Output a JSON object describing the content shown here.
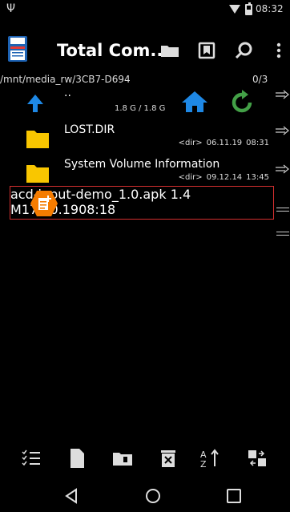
{
  "status_bar": {
    "usb_glyph": "Ψ",
    "time": "08:32",
    "icons": [
      "usb-icon",
      "wifi-icon",
      "battery-icon"
    ]
  },
  "toolbar": {
    "title": "Total Com...",
    "buttons": [
      "folder-icon",
      "bookmark-icon",
      "search-icon",
      "more-vert-icon"
    ]
  },
  "path_bar": {
    "path": "/mnt/media_rw/3CB7-D694",
    "count": "0/3"
  },
  "file_list": {
    "up_row": {
      "name": "..",
      "size": "1.8 G / 1.8 G"
    },
    "items": [
      {
        "name": "LOST.DIR",
        "size": "<dir>",
        "date": "06.11.19",
        "time": "08:31",
        "icon": "folder-icon"
      },
      {
        "name": "System Volume Information",
        "size": "<dir>",
        "date": "09.12.14",
        "time": "13:45",
        "icon": "folder-icon"
      },
      {
        "name": "acd-input-demo_1.0.apk",
        "size": "1.4 M",
        "date": "17.10.19",
        "time": "08:18",
        "icon": "apk-icon"
      }
    ]
  },
  "bottom_bar": {
    "buttons": [
      "select-icon",
      "new-file-icon",
      "copy-folder-icon",
      "delete-icon",
      "sort-icon",
      "compare-icon"
    ]
  },
  "nav_bar": {
    "buttons": [
      "back-icon",
      "home-circle-icon",
      "recents-icon"
    ]
  },
  "colors": {
    "background": "#000000",
    "folder": "#f9c600",
    "apk": "#f57c00",
    "up_arrow": "#1e88e5",
    "home": "#1e88e5",
    "refresh": "#43a047",
    "selection_border": "#d32f2f"
  }
}
